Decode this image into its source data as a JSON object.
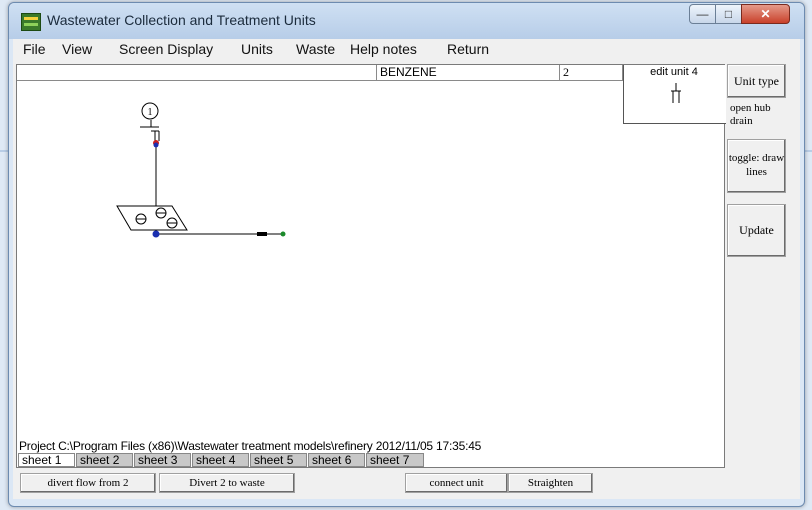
{
  "window": {
    "title": "Wastewater Collection and Treatment Units",
    "minimize": "—",
    "maximize": "□",
    "close": "✕"
  },
  "menu": [
    "File",
    "View",
    "Screen Display",
    "Units",
    "Waste",
    "Help notes",
    "Return"
  ],
  "toolbar": {
    "text_value": "",
    "chemical": "BENZENE",
    "unit_number": "2"
  },
  "edit_panel": {
    "label": "edit unit  4"
  },
  "side": {
    "unit_type": "Unit type",
    "unit_type_value": "open hub drain",
    "toggle": "toggle: draw lines",
    "update": "Update"
  },
  "diagram": {
    "node_label": "1"
  },
  "status": "Project C:\\Program Files (x86)\\Wastewater treatment models\\refinery 2012/11/05 17:35:45",
  "sheets": [
    "sheet  1",
    "sheet  2",
    "sheet  3",
    "sheet  4",
    "sheet  5",
    "sheet  6",
    "sheet  7"
  ],
  "active_sheet": "sheet  1",
  "bottom_buttons": {
    "divert_flow": "divert flow from  2",
    "divert_waste": "Divert 2 to waste",
    "connect": "connect unit",
    "straighten": "Straighten"
  },
  "colors": {
    "node_red": "#cc1f1f",
    "node_blue": "#1a2fb0",
    "node_green": "#1a8a2a"
  }
}
